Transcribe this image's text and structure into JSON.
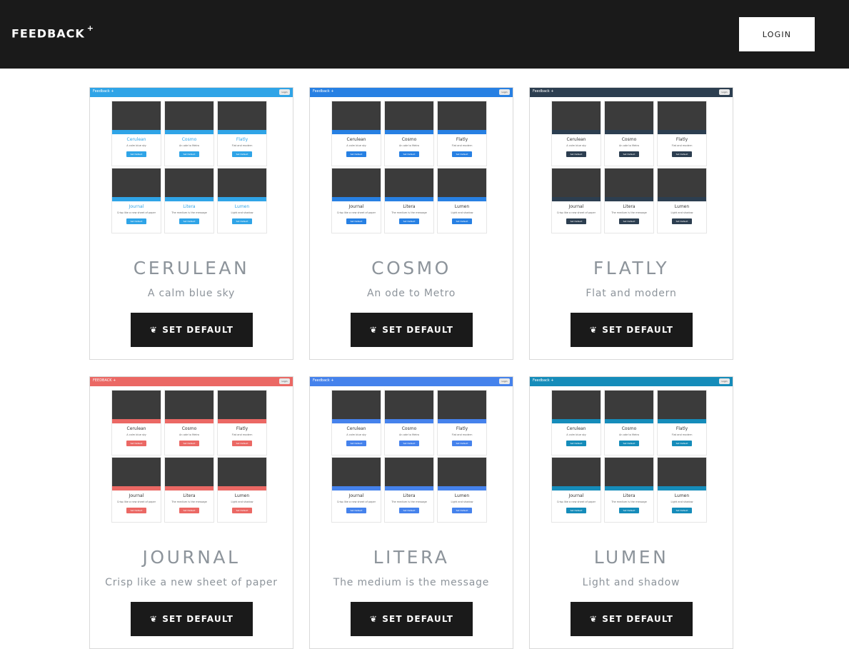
{
  "navbar": {
    "brand": "FEEDBACK",
    "brand_sup": "+",
    "login_label": "LOGIN"
  },
  "cards": [
    {
      "title": "CERULEAN",
      "desc": "A calm blue sky",
      "button_label": "SET DEFAULT",
      "button_icon": "leaf-icon",
      "thumb": {
        "bar_color": "#2fa4e7",
        "accent": "#2fa4e7",
        "brand": "Feedback +",
        "login": "Login",
        "minis": [
          {
            "name": "Cerulean",
            "desc": "A calm blue sky",
            "btn": "Set Default"
          },
          {
            "name": "Cosmo",
            "desc": "An ode to Metro",
            "btn": "Set Default"
          },
          {
            "name": "Flatly",
            "desc": "Flat and modern",
            "btn": "Set Default"
          },
          {
            "name": "Journal",
            "desc": "Crisp like a new sheet of paper",
            "btn": "Set Default"
          },
          {
            "name": "Litera",
            "desc": "The medium is the message",
            "btn": "Set Default"
          },
          {
            "name": "Lumen",
            "desc": "Light and shadow",
            "btn": "Set Default"
          }
        ]
      }
    },
    {
      "title": "COSMO",
      "desc": "An ode to Metro",
      "button_label": "SET DEFAULT",
      "button_icon": "leaf-icon",
      "thumb": {
        "bar_color": "#2780e3",
        "accent": "#2780e3",
        "brand": "Feedback +",
        "login": "Login",
        "minis": [
          {
            "name": "Cerulean",
            "desc": "A calm blue sky",
            "btn": "Set Default"
          },
          {
            "name": "Cosmo",
            "desc": "An ode to Metro",
            "btn": "Set Default"
          },
          {
            "name": "Flatly",
            "desc": "Flat and modern",
            "btn": "Set Default"
          },
          {
            "name": "Journal",
            "desc": "Crisp like a new sheet of paper",
            "btn": "Set Default"
          },
          {
            "name": "Litera",
            "desc": "The medium is the message",
            "btn": "Set Default"
          },
          {
            "name": "Lumen",
            "desc": "Light and shadow",
            "btn": "Set Default"
          }
        ]
      }
    },
    {
      "title": "FLATLY",
      "desc": "Flat and modern",
      "button_label": "SET DEFAULT",
      "button_icon": "leaf-icon",
      "thumb": {
        "bar_color": "#2c3e50",
        "accent": "#2c3e50",
        "brand": "Feedback +",
        "login": "Login",
        "minis": [
          {
            "name": "Cerulean",
            "desc": "A calm blue sky",
            "btn": "Set Default"
          },
          {
            "name": "Cosmo",
            "desc": "An ode to Metro",
            "btn": "Set Default"
          },
          {
            "name": "Flatly",
            "desc": "Flat and modern",
            "btn": "Set Default"
          },
          {
            "name": "Journal",
            "desc": "Crisp like a new sheet of paper",
            "btn": "Set Default"
          },
          {
            "name": "Litera",
            "desc": "The medium is the message",
            "btn": "Set Default"
          },
          {
            "name": "Lumen",
            "desc": "Light and shadow",
            "btn": "Set Default"
          }
        ]
      }
    },
    {
      "title": "JOURNAL",
      "desc": "Crisp like a new sheet of paper",
      "button_label": "SET DEFAULT",
      "button_icon": "leaf-icon",
      "thumb": {
        "bar_color": "#eb6864",
        "accent": "#eb6864",
        "brand": "FEEDBACK +",
        "login": "Login",
        "minis": [
          {
            "name": "Cerulean",
            "desc": "A calm blue sky",
            "btn": "Set Default"
          },
          {
            "name": "Cosmo",
            "desc": "An ode to Metro",
            "btn": "Set Default"
          },
          {
            "name": "Flatly",
            "desc": "Flat and modern",
            "btn": "Set Default"
          },
          {
            "name": "Journal",
            "desc": "Crisp like a new sheet of paper",
            "btn": "Set Default"
          },
          {
            "name": "Litera",
            "desc": "The medium is the message",
            "btn": "Set Default"
          },
          {
            "name": "Lumen",
            "desc": "Light and shadow",
            "btn": "Set Default"
          }
        ]
      }
    },
    {
      "title": "LITERA",
      "desc": "The medium is the message",
      "button_label": "SET DEFAULT",
      "button_icon": "leaf-icon",
      "thumb": {
        "bar_color": "#4582ec",
        "accent": "#4582ec",
        "brand": "Feedback +",
        "login": "Login",
        "minis": [
          {
            "name": "Cerulean",
            "desc": "A calm blue sky",
            "btn": "Set Default"
          },
          {
            "name": "Cosmo",
            "desc": "An ode to Metro",
            "btn": "Set Default"
          },
          {
            "name": "Flatly",
            "desc": "Flat and modern",
            "btn": "Set Default"
          },
          {
            "name": "Journal",
            "desc": "Crisp like a new sheet of paper",
            "btn": "Set Default"
          },
          {
            "name": "Litera",
            "desc": "The medium is the message",
            "btn": "Set Default"
          },
          {
            "name": "Lumen",
            "desc": "Light and shadow",
            "btn": "Set Default"
          }
        ]
      }
    },
    {
      "title": "LUMEN",
      "desc": "Light and shadow",
      "button_label": "SET DEFAULT",
      "button_icon": "leaf-icon",
      "thumb": {
        "bar_color": "#158cba",
        "accent": "#158cba",
        "brand": "Feedback +",
        "login": "Login",
        "minis": [
          {
            "name": "Cerulean",
            "desc": "A calm blue sky",
            "btn": "Set Default"
          },
          {
            "name": "Cosmo",
            "desc": "An ode to Metro",
            "btn": "Set Default"
          },
          {
            "name": "Flatly",
            "desc": "Flat and modern",
            "btn": "Set Default"
          },
          {
            "name": "Journal",
            "desc": "Crisp like a new sheet of paper",
            "btn": "Set Default"
          },
          {
            "name": "Litera",
            "desc": "The medium is the message",
            "btn": "Set Default"
          },
          {
            "name": "Lumen",
            "desc": "Light and shadow",
            "btn": "Set Default"
          }
        ]
      }
    }
  ]
}
